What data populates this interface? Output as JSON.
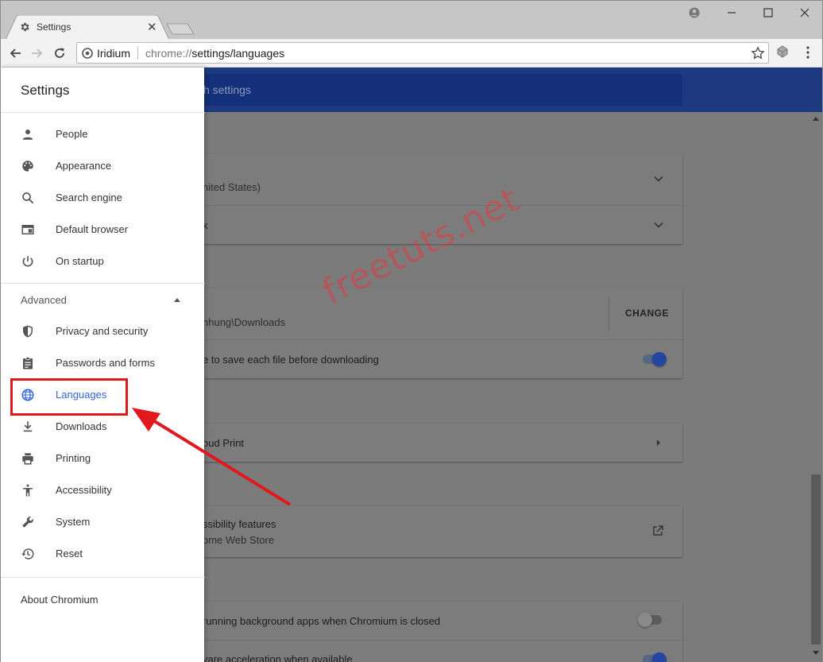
{
  "browser": {
    "tab_title": "Settings",
    "site_name": "Iridium",
    "url_scheme": "chrome://",
    "url_path": "settings/languages"
  },
  "page": {
    "search_placeholder": "Search settings",
    "search_visible": "h settings",
    "languages_card": {
      "row1": "nited States)",
      "row2": "k"
    },
    "downloads_card": {
      "location": "nhung\\Downloads",
      "change_label": "CHANGE",
      "ask_label": "e to save each file before downloading",
      "ask_toggle": "on"
    },
    "printing_card": {
      "cloud_print": "oud Print"
    },
    "accessibility_card": {
      "title": "ssibility features",
      "sub": "ome Web Store"
    },
    "system_card": {
      "bg_apps": "running background apps when Chromium is closed",
      "bg_apps_toggle": "off",
      "hw_accel": "vare acceleration when available",
      "hw_accel_toggle": "on"
    }
  },
  "drawer": {
    "title": "Settings",
    "items": [
      {
        "label": "People",
        "icon": "person-icon"
      },
      {
        "label": "Appearance",
        "icon": "palette-icon"
      },
      {
        "label": "Search engine",
        "icon": "search-icon"
      },
      {
        "label": "Default browser",
        "icon": "browser-window-icon"
      },
      {
        "label": "On startup",
        "icon": "power-icon"
      }
    ],
    "advanced_label": "Advanced",
    "advanced_items": [
      {
        "label": "Privacy and security",
        "icon": "shield-icon"
      },
      {
        "label": "Passwords and forms",
        "icon": "clipboard-icon"
      },
      {
        "label": "Languages",
        "icon": "globe-icon"
      },
      {
        "label": "Downloads",
        "icon": "download-icon"
      },
      {
        "label": "Printing",
        "icon": "printer-icon"
      },
      {
        "label": "Accessibility",
        "icon": "accessibility-icon"
      },
      {
        "label": "System",
        "icon": "wrench-icon"
      },
      {
        "label": "Reset",
        "icon": "history-icon"
      }
    ],
    "about": "About Chromium"
  },
  "annotations": {
    "watermark": "freetuts.net",
    "highlight_color": "#e0191e"
  },
  "colors": {
    "accent": "#3367d6",
    "header_blue": "#1d3a80"
  }
}
